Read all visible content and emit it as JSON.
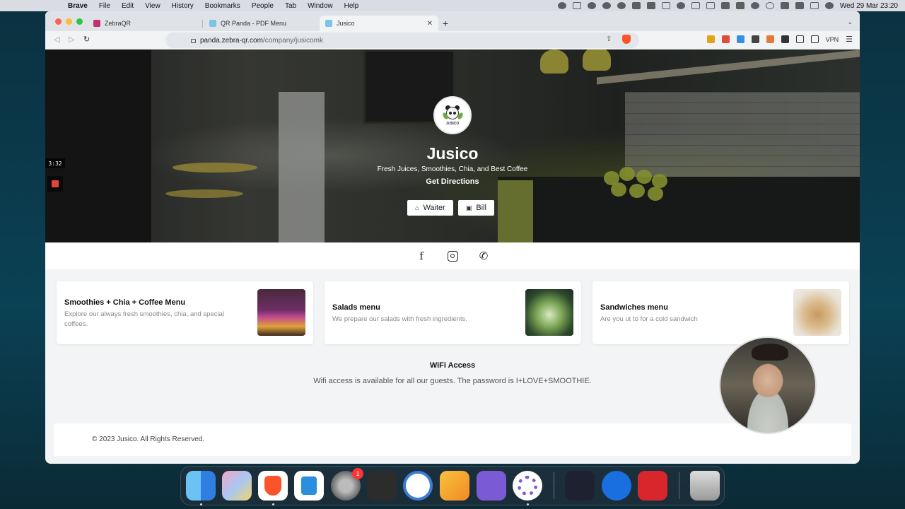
{
  "menubar": {
    "app": "Brave",
    "items": [
      "File",
      "Edit",
      "View",
      "History",
      "Bookmarks",
      "People",
      "Tab",
      "Window",
      "Help"
    ],
    "clock": "Wed 29 Mar  23:20"
  },
  "browser": {
    "tabs": [
      {
        "label": "ZebraQR",
        "favicon_color": "#c2306f"
      },
      {
        "label": "QR Panda - PDF Menu",
        "favicon_color": "#7ec3e6"
      },
      {
        "label": "Jusico",
        "favicon_color": "#7ec3e6",
        "active": true
      }
    ],
    "new_tab": "+",
    "url_host": "panda.zebra-qr.com",
    "url_path": "/company/jusicomk",
    "vpn_label": "VPN"
  },
  "hero": {
    "brand": "Jusico",
    "logo_text": "JUSICO",
    "tagline": "Fresh Juices, Smoothies, Chia, and Best Coffee",
    "directions": "Get Directions",
    "waiter_label": "Waiter",
    "bill_label": "Bill"
  },
  "recording": {
    "time": "3:32"
  },
  "social": {
    "icons": [
      "facebook-icon",
      "instagram-icon",
      "phone-icon"
    ]
  },
  "menus": [
    {
      "title": "Smoothies + Chia + Coffee Menu",
      "description": "Explore our always fresh smoothies, chia, and special coffees."
    },
    {
      "title": "Salads menu",
      "description": "We prepare our salads with fresh ingredients."
    },
    {
      "title": "Sandwiches menu",
      "description": "Are you ut to for a cold sandwich"
    }
  ],
  "wifi": {
    "title": "WiFi Access",
    "text": "Wifi access is available for all our guests. The password is I+LOVE+SMOOTHIE."
  },
  "footer": {
    "copyright": "© 2023 Jusico. All Rights Reserved."
  },
  "dock": {
    "settings_badge": "1"
  },
  "colors": {
    "brave_orange": "#fb542b",
    "page_bg": "#f3f4f5",
    "accent_red": "#e0443a"
  }
}
